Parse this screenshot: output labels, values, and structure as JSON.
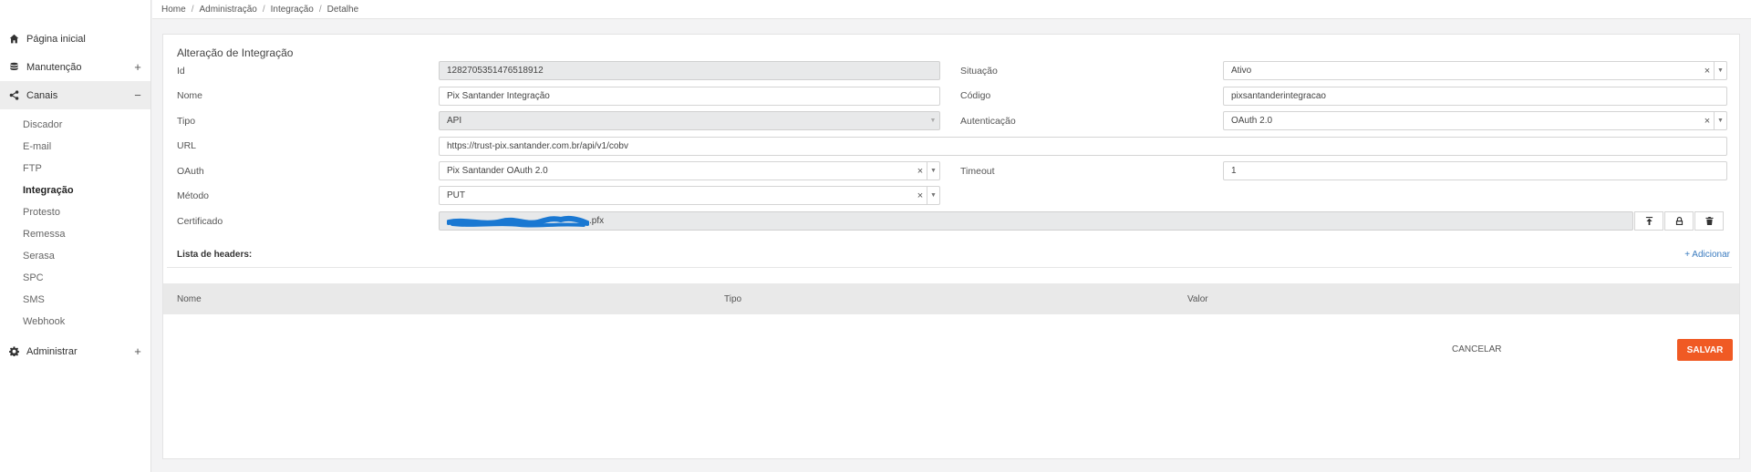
{
  "breadcrumb": [
    "Home",
    "Administração",
    "Integração",
    "Detalhe"
  ],
  "sidebar": {
    "items": [
      {
        "label": "Página inicial",
        "icon": "home-icon"
      },
      {
        "label": "Manutenção",
        "icon": "database-icon",
        "toggle": "+"
      },
      {
        "label": "Canais",
        "icon": "share-icon",
        "toggle": "−"
      },
      {
        "label": "Administrar",
        "icon": "gear-icon",
        "toggle": "+"
      }
    ],
    "sub_items": [
      "Discador",
      "E-mail",
      "FTP",
      "Integração",
      "Protesto",
      "Remessa",
      "Serasa",
      "SPC",
      "SMS",
      "Webhook"
    ]
  },
  "form": {
    "title": "Alteração de Integração",
    "id_label": "Id",
    "id_value": "1282705351476518912",
    "situacao_label": "Situação",
    "situacao_value": "Ativo",
    "nome_label": "Nome",
    "nome_value": "Pix Santander Integração",
    "codigo_label": "Código",
    "codigo_value": "pixsantanderintegracao",
    "tipo_label": "Tipo",
    "tipo_value": "API",
    "autenticacao_label": "Autenticação",
    "autenticacao_value": "OAuth 2.0",
    "url_label": "URL",
    "url_value": "https://trust-pix.santander.com.br/api/v1/cobv",
    "oauth_label": "OAuth",
    "oauth_value": "Pix Santander OAuth 2.0",
    "timeout_label": "Timeout",
    "timeout_value": "1",
    "metodo_label": "Método",
    "metodo_value": "PUT",
    "certificado_label": "Certificado",
    "certificado_value": ".pfx",
    "clear_glyph": "×",
    "caret_glyph": "▼"
  },
  "headers": {
    "title": "Lista de headers:",
    "add_label": "+ Adicionar",
    "columns": [
      "Nome",
      "Tipo",
      "Valor"
    ]
  },
  "actions": {
    "cancel_label": "CANCELAR",
    "save_label": "SALVAR"
  },
  "colors": {
    "accent": "#f05a24",
    "link": "#3a7bbf",
    "scribble": "#1a78d2"
  }
}
